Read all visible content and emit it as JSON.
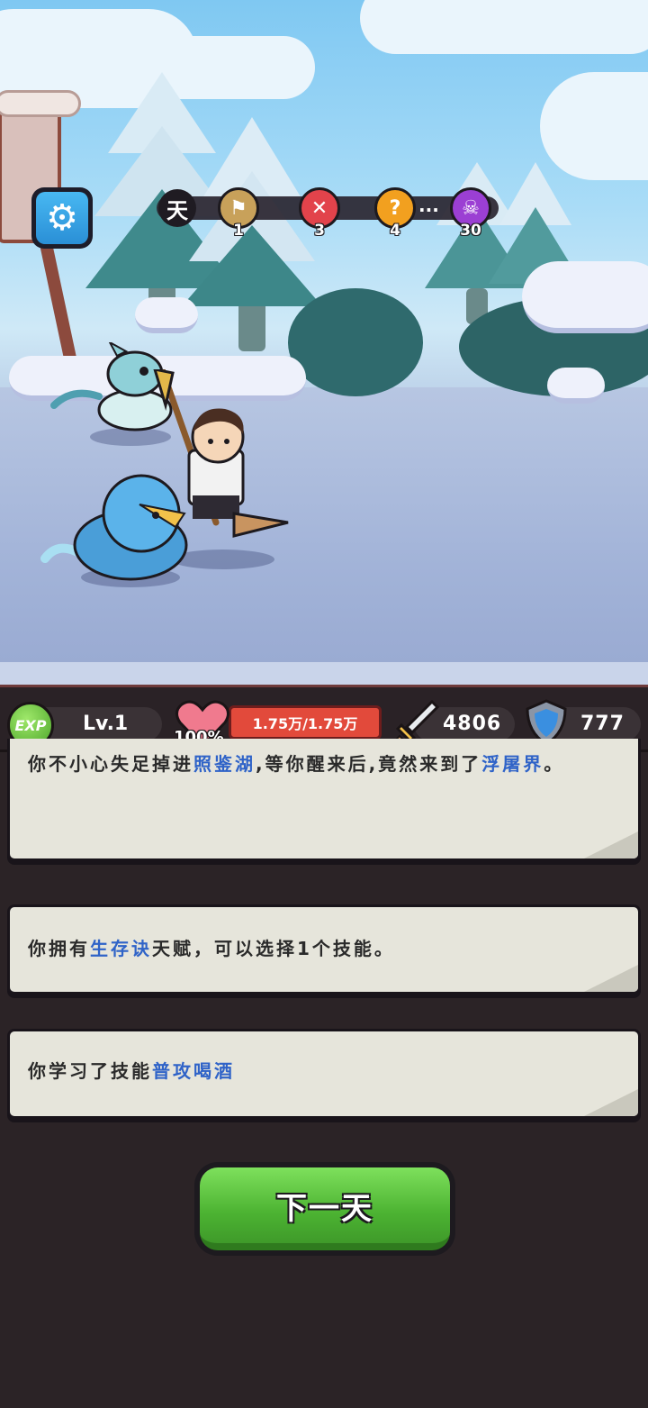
{
  "progress": {
    "day_label": "天",
    "nodes": [
      {
        "icon": "flag-icon",
        "label": "1",
        "color": "#c8a15a"
      },
      {
        "icon": "crossed-swords-icon",
        "label": "3",
        "color": "#e2434b"
      },
      {
        "icon": "question-icon",
        "label": "4",
        "color": "#f2a01f"
      },
      {
        "icon": "skull-icon",
        "label": "30",
        "color": "#9b3fd3"
      }
    ],
    "ellipsis": "..."
  },
  "stats": {
    "exp_icon_text": "EXP",
    "level": "Lv.1",
    "hp_percent": "100%",
    "hp": "1.75万/1.75万",
    "attack": "4806",
    "defense": "777"
  },
  "log": {
    "card1": {
      "t1": "你不小心失足掉进",
      "h1": "照鉴湖",
      "t2": ",等你醒来后,竟然来到了",
      "h2": "浮屠界",
      "t3": "。"
    },
    "card2": {
      "t1": "你拥有",
      "h1": "生存诀",
      "t2": "天赋，可以选择1个技能。"
    },
    "card3": {
      "t1": "你学习了技能",
      "h1": "普攻喝酒"
    }
  },
  "next_button": "下一天",
  "colors": {
    "highlight": "#2f63c8",
    "button_green": "#4cb332",
    "hp_red": "#e24a3b"
  }
}
